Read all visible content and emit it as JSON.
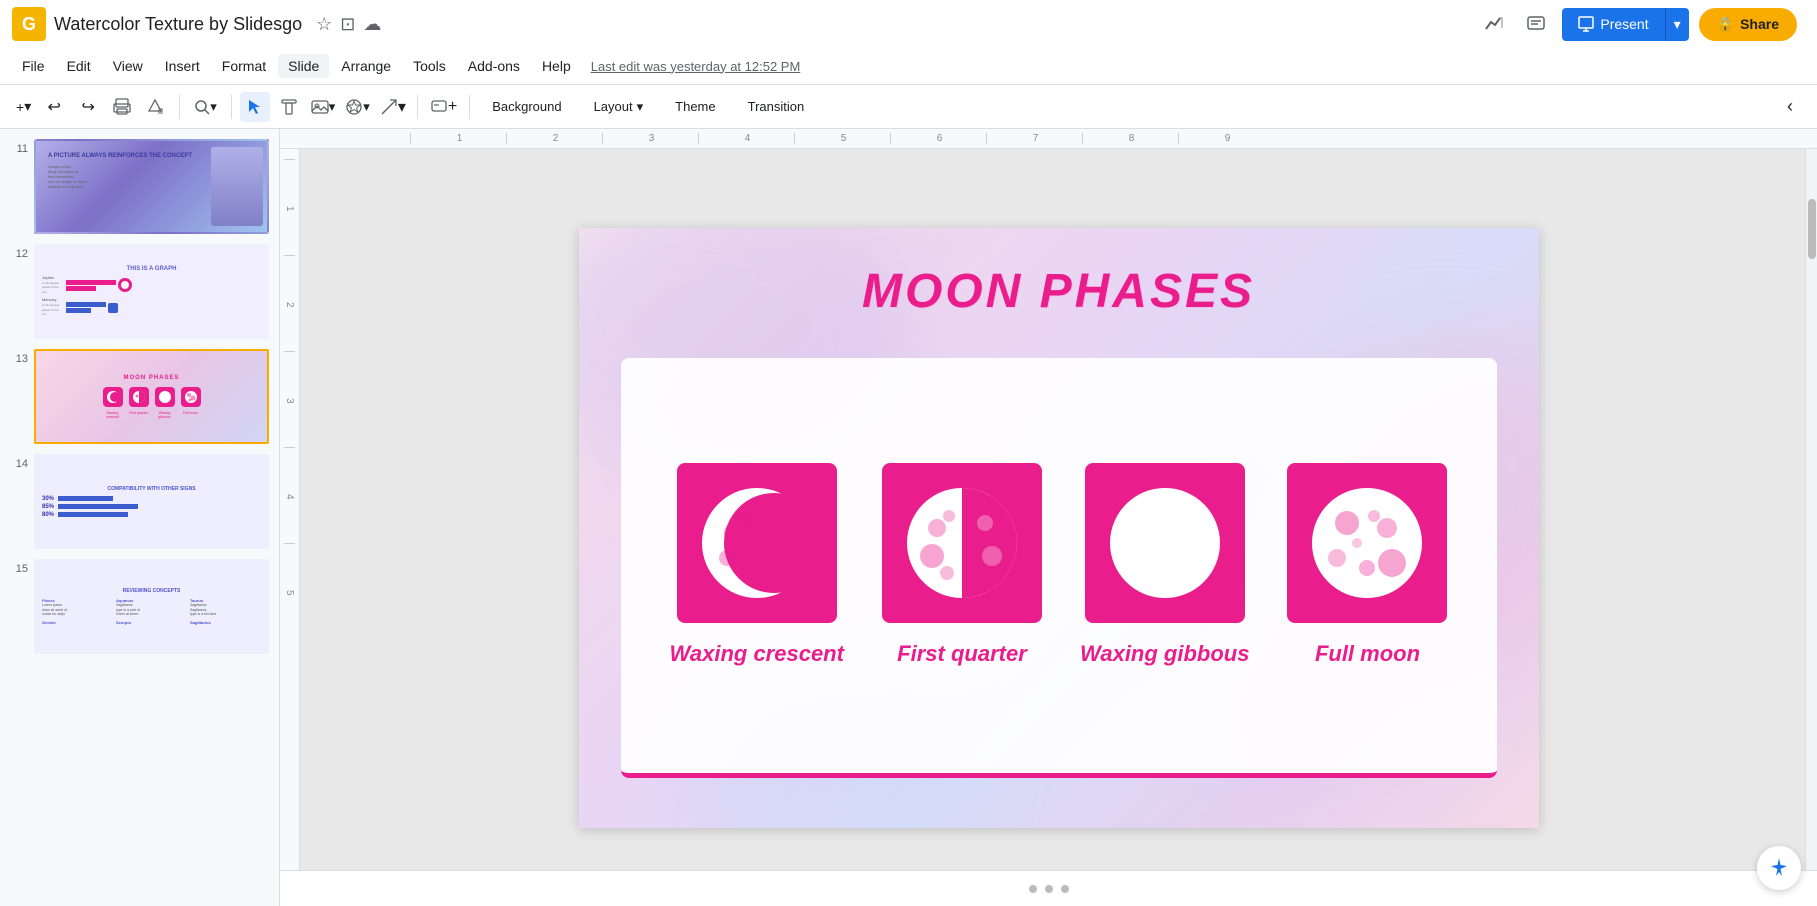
{
  "app": {
    "logo": "G",
    "doc_title": "Watercolor Texture by Slidesgo",
    "last_edit": "Last edit was yesterday at 12:52 PM"
  },
  "toolbar_right": {
    "analytics_icon": "📈",
    "comments_icon": "💬",
    "present_icon": "▶",
    "present_label": "Present",
    "present_dropdown": "▾",
    "share_icon": "🔒",
    "share_label": "Share"
  },
  "menu": {
    "items": [
      "File",
      "Edit",
      "View",
      "Insert",
      "Format",
      "Slide",
      "Arrange",
      "Tools",
      "Add-ons",
      "Help"
    ]
  },
  "toolbar": {
    "add_slide": "+",
    "undo": "↩",
    "redo": "↪",
    "print": "🖨",
    "paint_format": "🎨",
    "zoom_label": "🔍",
    "select_tool": "↖",
    "text_tool": "T",
    "image_tool": "🖼",
    "shape_tool": "⬡",
    "line_tool": "/",
    "comment_tool": "+💬",
    "background_label": "Background",
    "layout_label": "Layout",
    "layout_arrow": "▾",
    "theme_label": "Theme",
    "transition_label": "Transition"
  },
  "ruler": {
    "marks": [
      "1",
      "2",
      "3",
      "4",
      "5",
      "6",
      "7",
      "8",
      "9"
    ],
    "v_marks": [
      "1",
      "2",
      "3",
      "4",
      "5"
    ]
  },
  "slides": [
    {
      "number": "11",
      "title": "A PICTURE ALWAYS REINFORCES THE CONCEPT",
      "theme": "purple"
    },
    {
      "number": "12",
      "title": "THIS IS A GRAPH",
      "theme": "lavender"
    },
    {
      "number": "13",
      "title": "MOON PHASES",
      "theme": "pink",
      "selected": true
    },
    {
      "number": "14",
      "title": "COMPATIBILITY WITH OTHER SIGNS",
      "theme": "lavender"
    },
    {
      "number": "15",
      "title": "REVIEWING CONCEPTS",
      "theme": "lavender"
    }
  ],
  "main_slide": {
    "title": "MOON PHASES",
    "phases": [
      {
        "label": "Waxing crescent",
        "type": "waxing_crescent"
      },
      {
        "label": "First quarter",
        "type": "first_quarter"
      },
      {
        "label": "Waxing gibbous",
        "type": "waxing_gibbous"
      },
      {
        "label": "Full moon",
        "type": "full_moon"
      }
    ]
  },
  "colors": {
    "pink": "#e91e8c",
    "slide_bg_start": "#fae8f0",
    "slide_bg_end": "#f5d8e8",
    "card_border": "#e91e8c",
    "icon_bg": "#e91e8c",
    "text_pink": "#e91e8c"
  },
  "bottom_dots": [
    "dot1",
    "dot2",
    "dot3"
  ],
  "smart_compose": "✨"
}
